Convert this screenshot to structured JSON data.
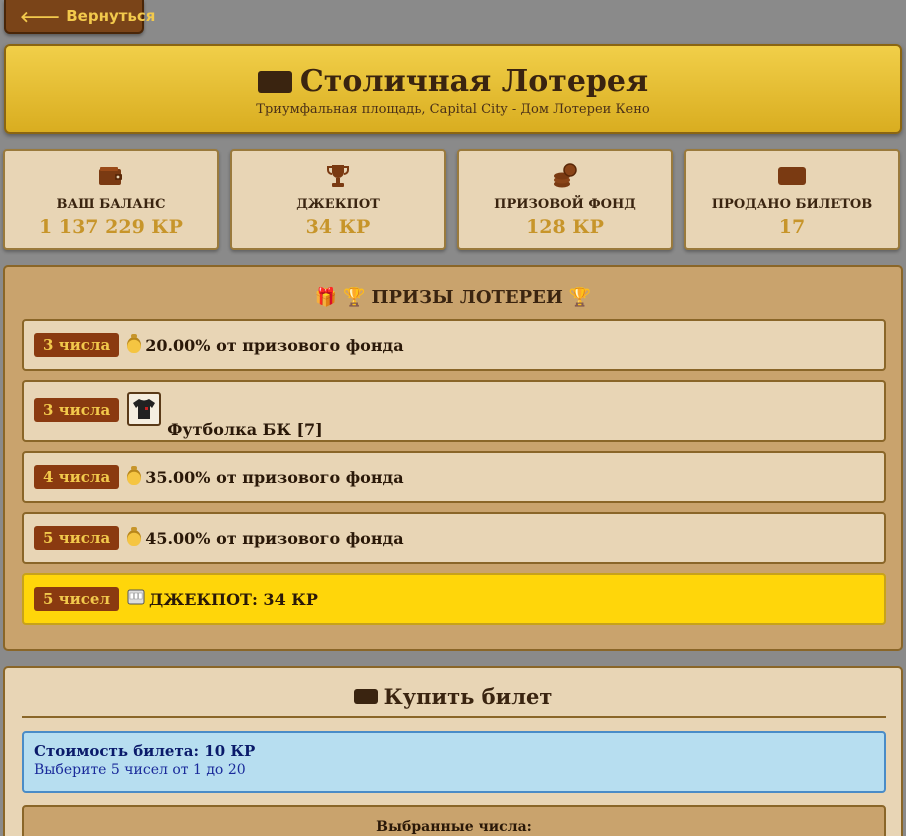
{
  "nav": {
    "back_label": "Вернуться"
  },
  "header": {
    "title": "Столичная Лотерея",
    "subtitle": "Триумфальная площадь, Capital City - Дом Лотереи Кено"
  },
  "stats": [
    {
      "icon": "wallet-icon",
      "label": "ВАШ БАЛАНС",
      "value": "1 137 229 КР"
    },
    {
      "icon": "trophy-icon",
      "label": "ДЖЕКПОТ",
      "value": "34 КР"
    },
    {
      "icon": "coins-icon",
      "label": "ПРИЗОВОЙ ФОНД",
      "value": "128 КР"
    },
    {
      "icon": "ticket-icon",
      "label": "ПРОДАНО БИЛЕТОВ",
      "value": "17"
    }
  ],
  "prizes": {
    "title": "ПРИЗЫ ЛОТЕРЕИ",
    "items": [
      {
        "badge": "3 числа",
        "icon": "moneybag-icon",
        "text": "20.00% от призового фонда"
      },
      {
        "badge": "3 числа",
        "icon": "tshirt-icon",
        "text": "Футболка БК [7]"
      },
      {
        "badge": "4 числа",
        "icon": "moneybag-icon",
        "text": "35.00% от призового фонда"
      },
      {
        "badge": "5 числа",
        "icon": "moneybag-icon",
        "text": "45.00% от призового фонда"
      },
      {
        "badge": "5 чисел",
        "icon": "slot-machine-icon",
        "text": "ДЖЕКПОТ: 34 КР"
      }
    ]
  },
  "buy": {
    "title": "Купить билет",
    "cost": "Стоимость билета: 10 КР",
    "hint": "Выберите 5 чисел от 1 до 20",
    "selected_label": "Выбранные числа:"
  },
  "colors": {
    "accent_gold": "#d9ad20",
    "jackpot_yellow": "#ffd60a",
    "badge_brown": "#8a3a10",
    "info_blue": "#b7def0"
  }
}
